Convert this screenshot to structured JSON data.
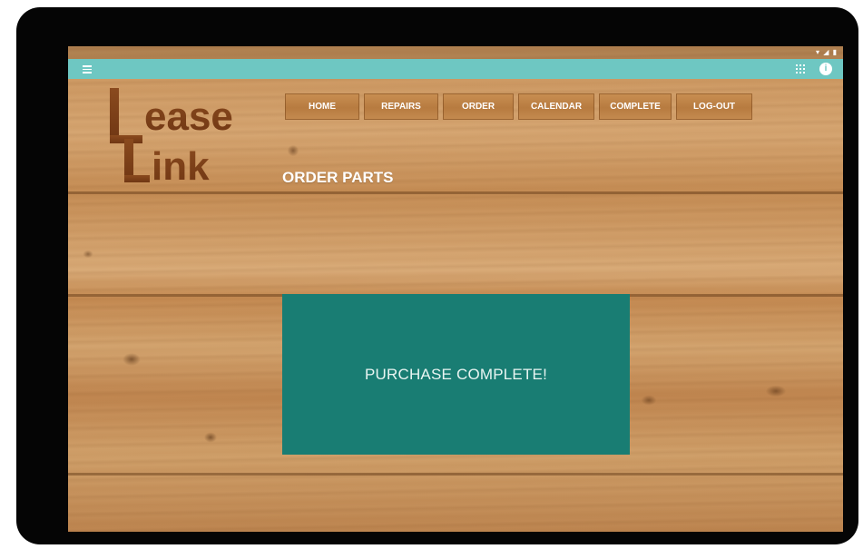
{
  "status_bar": {
    "icons": [
      "wifi-icon",
      "signal-icon",
      "battery-icon"
    ],
    "time": ""
  },
  "app_bar": {
    "color": "#6ec7c2",
    "left_icon": "menu-icon",
    "right_icons": [
      "grid-icon",
      "info-icon"
    ],
    "info_glyph": "i"
  },
  "logo": {
    "line1": "ease",
    "line2": "ink",
    "initial": "L"
  },
  "nav": {
    "items": [
      {
        "label": "HOME"
      },
      {
        "label": "REPAIRS"
      },
      {
        "label": "ORDER"
      },
      {
        "label": "CALENDAR"
      },
      {
        "label": "COMPLETE"
      },
      {
        "label": "LOG-OUT"
      }
    ]
  },
  "page": {
    "title": "ORDER PARTS"
  },
  "confirmation": {
    "message": "PURCHASE COMPLETE!",
    "color": "#197d73"
  }
}
